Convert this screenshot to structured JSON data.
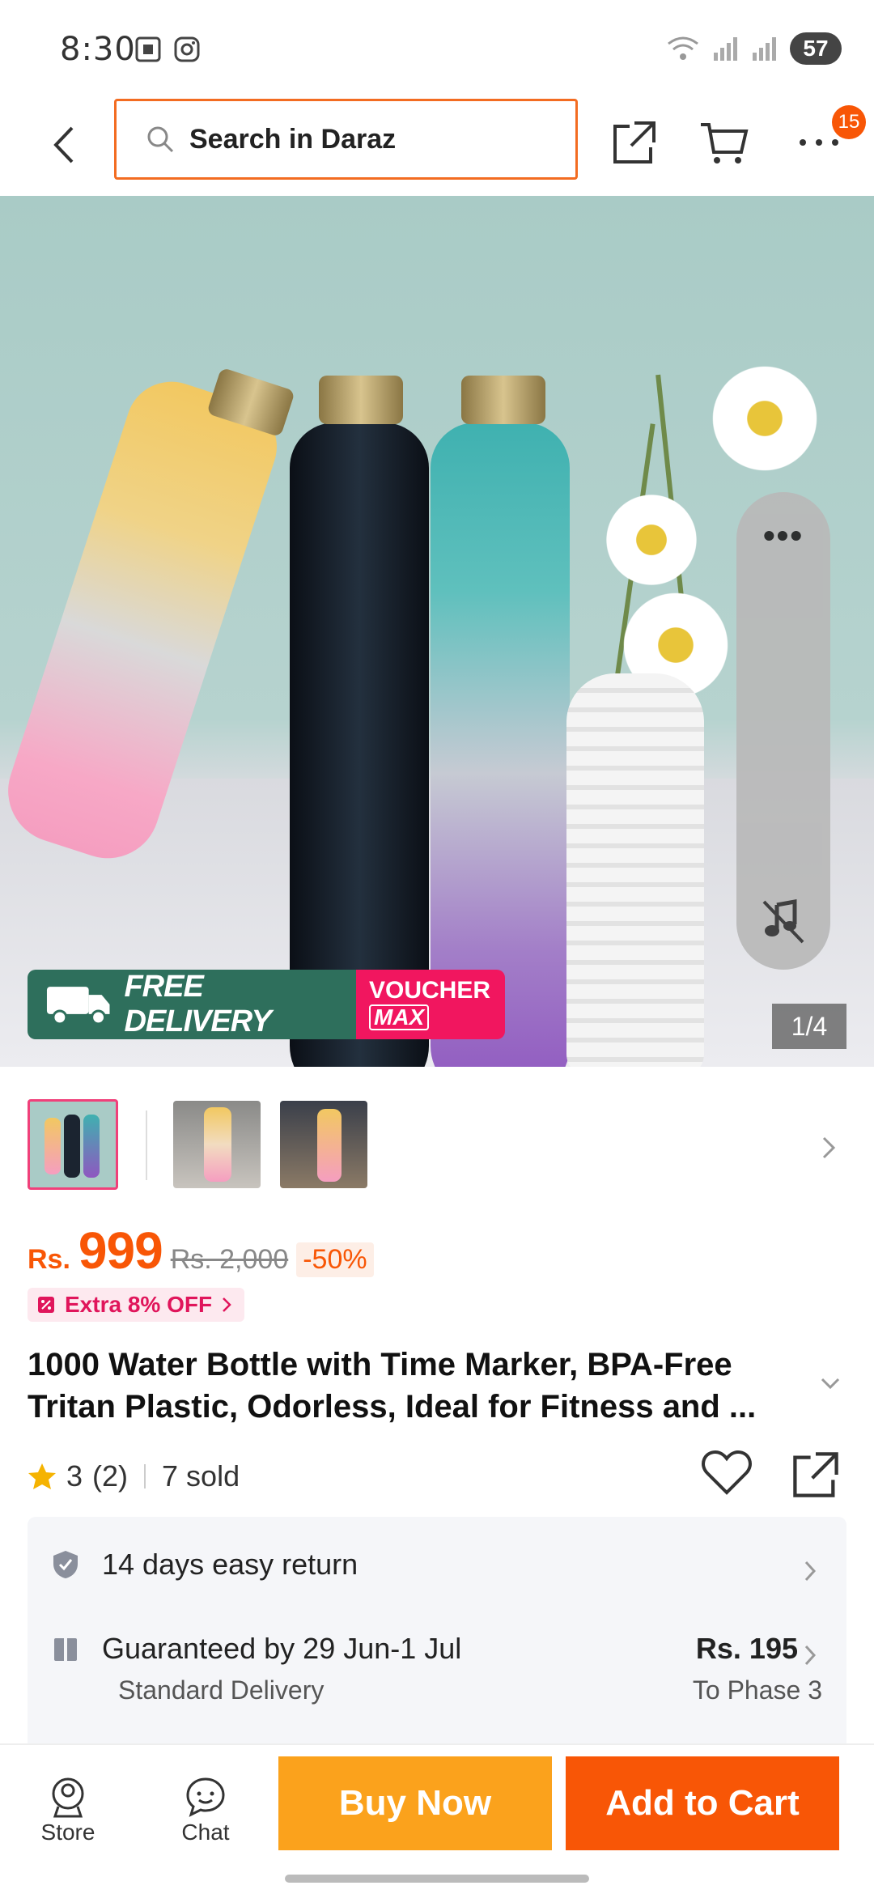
{
  "status": {
    "time": "8:30",
    "battery": "57"
  },
  "header": {
    "search_placeholder": "Search in Daraz",
    "cart_badge": "15"
  },
  "gallery": {
    "banner_free_tag": "FREE",
    "banner_free_text": "FREE DELIVERY",
    "banner_voucher_top": "VOUCHER",
    "banner_voucher_bottom": "MAX",
    "counter": "1/4"
  },
  "product": {
    "currency": "Rs.",
    "price": "999",
    "old_price": "Rs. 2,000",
    "discount": "-50%",
    "extra_offer": "Extra 8% OFF",
    "title": "1000 Water Bottle with Time Marker, BPA-Free Tritan Plastic, Odorless, Ideal for Fitness and ...",
    "rating": "3",
    "rating_count": "(2)",
    "sold": "7 sold"
  },
  "info": {
    "return_text": "14 days easy return",
    "delivery_title": "Guaranteed by 29 Jun-1 Jul",
    "delivery_sub": "Standard Delivery",
    "delivery_price": "Rs. 195",
    "delivery_dest": "To Phase 3"
  },
  "bottom_bar": {
    "store_label": "Store",
    "chat_label": "Chat",
    "buy_now": "Buy Now",
    "add_to_cart": "Add to Cart"
  },
  "colors": {
    "accent": "#f85606",
    "buy_now": "#fba21c",
    "search_border": "#f36c21",
    "voucher": "#f1165f",
    "free_delivery": "#2e6f5c"
  }
}
